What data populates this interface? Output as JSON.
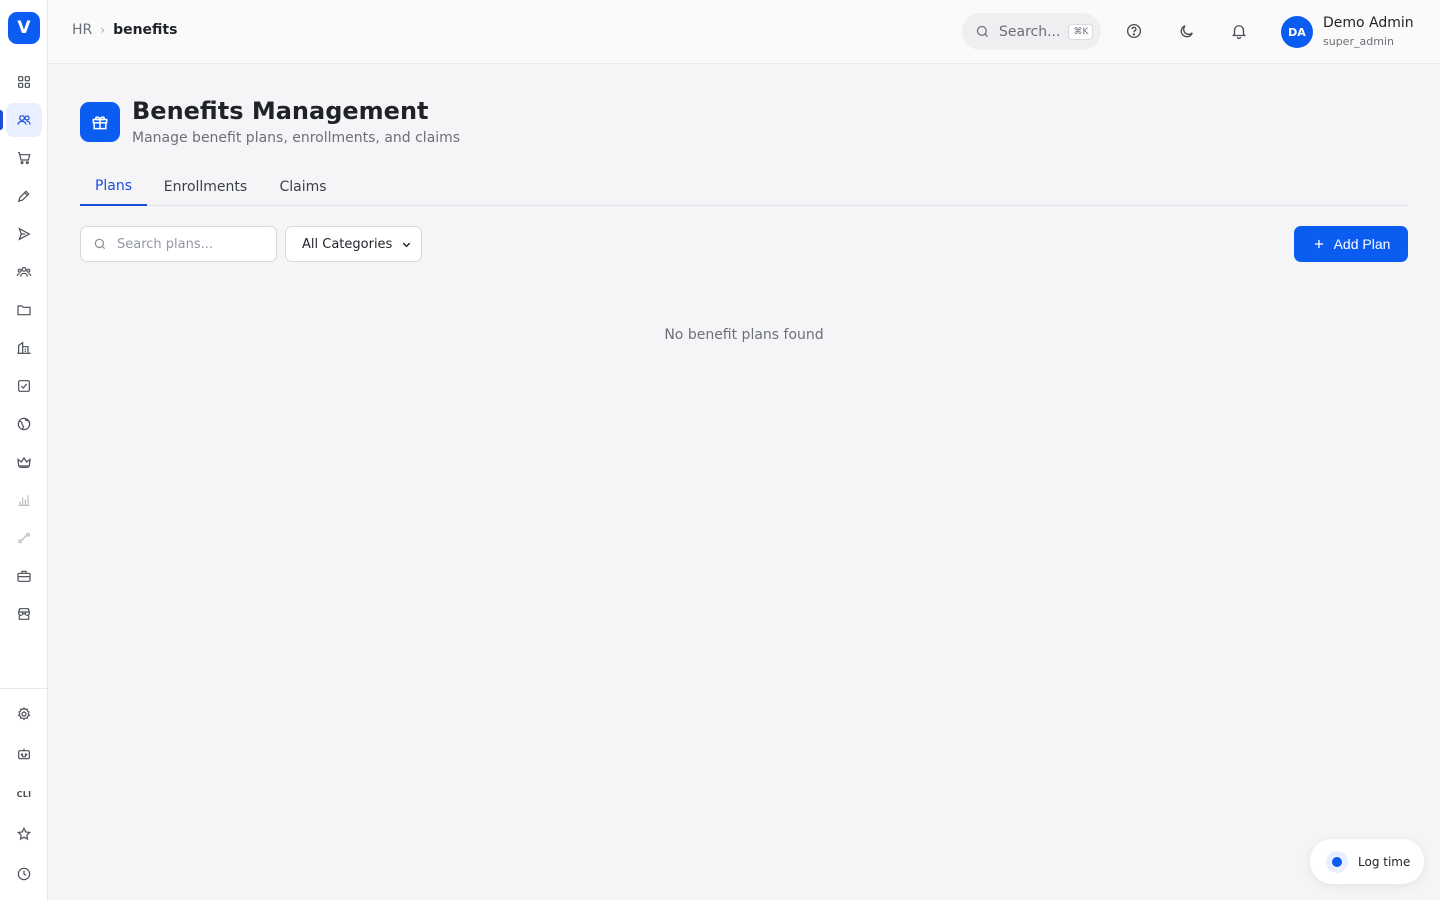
{
  "app": {
    "logo_letter": "V"
  },
  "breadcrumb": {
    "root": "HR",
    "current": "benefits"
  },
  "global_search": {
    "placeholder": "Search...",
    "shortcut": "⌘K"
  },
  "user": {
    "initials": "DA",
    "name": "Demo Admin",
    "role": "super_admin"
  },
  "sidebar": {
    "items": [
      {
        "icon": "dashboard-grid-icon"
      },
      {
        "icon": "users-icon",
        "active": true
      },
      {
        "icon": "cart-icon"
      },
      {
        "icon": "pen-icon"
      },
      {
        "icon": "send-icon"
      },
      {
        "icon": "team-icon"
      },
      {
        "icon": "folder-icon"
      },
      {
        "icon": "building-icon"
      },
      {
        "icon": "checkbox-icon"
      },
      {
        "icon": "globe-icon"
      },
      {
        "icon": "crown-icon"
      },
      {
        "icon": "bar-chart-icon"
      },
      {
        "icon": "route-icon"
      },
      {
        "icon": "briefcase-icon"
      },
      {
        "icon": "store-icon"
      }
    ],
    "bottom_items": [
      {
        "icon": "gear-icon"
      },
      {
        "icon": "bot-icon"
      },
      {
        "icon": "cli-icon",
        "label": "CLI"
      },
      {
        "icon": "star-icon"
      },
      {
        "icon": "clock-icon"
      }
    ]
  },
  "page": {
    "title": "Benefits Management",
    "subtitle": "Manage benefit plans, enrollments, and claims",
    "icon": "gift-icon"
  },
  "tabs": [
    {
      "label": "Plans",
      "active": true
    },
    {
      "label": "Enrollments",
      "active": false
    },
    {
      "label": "Claims",
      "active": false
    }
  ],
  "filters": {
    "search_placeholder": "Search plans...",
    "search_value": "",
    "category_selected": "All Categories"
  },
  "actions": {
    "add_plan_label": "Add Plan"
  },
  "empty_state": {
    "message": "No benefit plans found"
  },
  "log_time": {
    "label": "Log time"
  },
  "colors": {
    "primary": "#0b5cf0",
    "background": "#f5f5f7",
    "sidebar": "#ffffff"
  }
}
